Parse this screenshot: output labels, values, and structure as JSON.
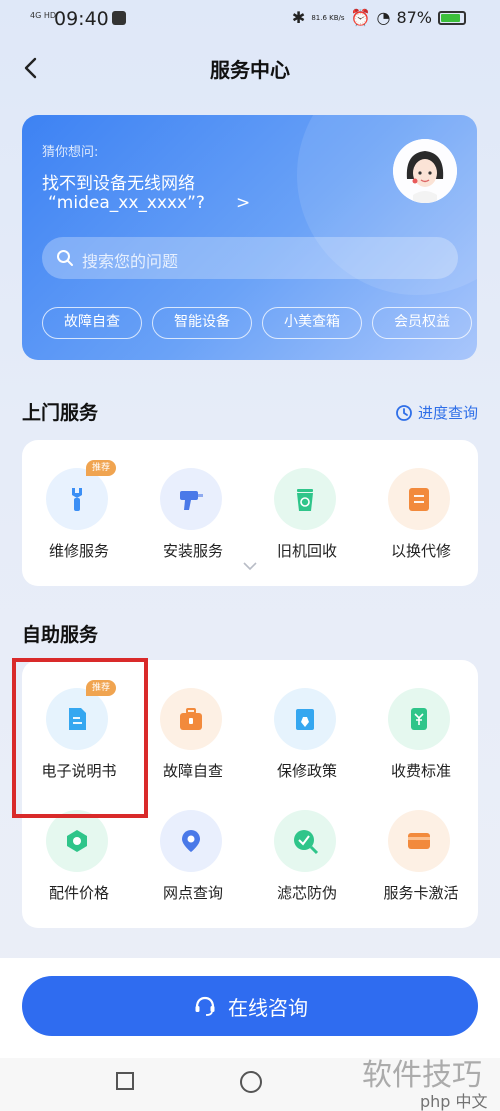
{
  "status_bar": {
    "network": "4G HD",
    "time": "09:40",
    "speed": "81.6 KB/s",
    "battery": "87%"
  },
  "header": {
    "title": "服务中心"
  },
  "hero": {
    "ask_label": "猜你想问:",
    "question_line1": "找不到设备无线网络",
    "question_line2": "“midea_xx_xxxx”?",
    "chevron": ">",
    "search_placeholder": "搜索您的问题",
    "chips": [
      "故障自查",
      "智能设备",
      "小美查箱",
      "会员权益"
    ]
  },
  "onsite": {
    "title": "上门服务",
    "progress_label": "进度查询",
    "items": [
      {
        "label": "维修服务",
        "badge": "推荐",
        "icon": "wrench-icon",
        "color": "#3b8ff5",
        "bg": "#e8f2fe"
      },
      {
        "label": "安装服务",
        "icon": "drill-icon",
        "color": "#4a79e8",
        "bg": "#e9effd"
      },
      {
        "label": "旧机回收",
        "icon": "recycle-bin-icon",
        "color": "#2fc58a",
        "bg": "#e5f8ef"
      },
      {
        "label": "以换代修",
        "icon": "exchange-icon",
        "color": "#f28a3c",
        "bg": "#fdf0e4"
      }
    ]
  },
  "selfservice": {
    "title": "自助服务",
    "items": [
      {
        "label": "电子说明书",
        "badge": "推荐",
        "icon": "document-icon",
        "color": "#35a7f0",
        "bg": "#e6f3fd"
      },
      {
        "label": "故障自查",
        "icon": "toolbox-icon",
        "color": "#f28a3c",
        "bg": "#fdf0e4"
      },
      {
        "label": "保修政策",
        "icon": "shield-doc-icon",
        "color": "#35a7f0",
        "bg": "#e6f3fd"
      },
      {
        "label": "收费标准",
        "icon": "price-icon",
        "color": "#2fc58a",
        "bg": "#e5f8ef"
      },
      {
        "label": "配件价格",
        "icon": "part-icon",
        "color": "#2fc58a",
        "bg": "#e5f8ef"
      },
      {
        "label": "网点查询",
        "icon": "location-icon",
        "color": "#4a79e8",
        "bg": "#e9effd"
      },
      {
        "label": "滤芯防伪",
        "icon": "filter-check-icon",
        "color": "#2fc58a",
        "bg": "#e5f8ef"
      },
      {
        "label": "服务卡激活",
        "icon": "card-icon",
        "color": "#f28a3c",
        "bg": "#fdf0e4"
      }
    ]
  },
  "consult": {
    "label": "在线咨询"
  },
  "watermark": {
    "main": "软件技巧",
    "sub": "php 中文网"
  }
}
